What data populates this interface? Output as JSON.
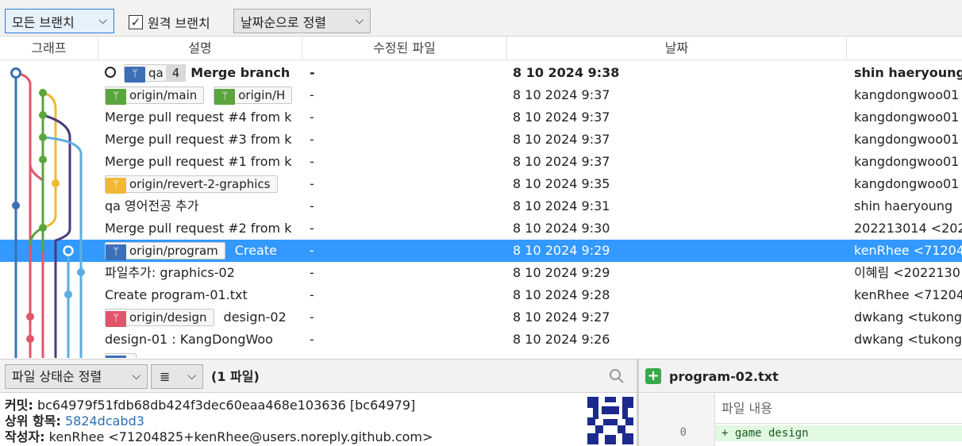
{
  "toolbar": {
    "branch_dropdown": "모든 브랜치",
    "remote_checkbox_label": "원격 브랜치",
    "remote_checked": true,
    "sort_dropdown": "날짜순으로 정렬"
  },
  "columns": {
    "graph": "그래프",
    "description": "설명",
    "files": "수정된 파일",
    "date": "날짜"
  },
  "commits": [
    {
      "branch_tag": "qa",
      "count_badge": "4",
      "description": "Merge branch",
      "files": "-",
      "date": "8 10 2024 9:38",
      "author": "shin haeryoung"
    },
    {
      "tags": [
        "origin/main",
        "origin/H"
      ],
      "files": "-",
      "date": "8 10 2024 9:37",
      "author": "kangdongwoo01"
    },
    {
      "description": "Merge pull request #4 from k",
      "files": "-",
      "date": "8 10 2024 9:37",
      "author": "kangdongwoo01"
    },
    {
      "description": "Merge pull request #3 from k",
      "files": "-",
      "date": "8 10 2024 9:37",
      "author": "kangdongwoo01"
    },
    {
      "description": "Merge pull request #1 from k",
      "files": "-",
      "date": "8 10 2024 9:37",
      "author": "kangdongwoo01"
    },
    {
      "tags": [
        "origin/revert-2-graphics"
      ],
      "files": "-",
      "date": "8 10 2024 9:35",
      "author": "kangdongwoo01"
    },
    {
      "description": "qa 영어전공 추가",
      "files": "-",
      "date": "8 10 2024 9:31",
      "author": "shin haeryoung"
    },
    {
      "description": "Merge pull request #2 from k",
      "files": "-",
      "date": "8 10 2024 9:30",
      "author": "202213014 <202"
    },
    {
      "tags": [
        "origin/program"
      ],
      "description": "Create",
      "files": "-",
      "date": "8 10 2024 9:29",
      "author": "kenRhee <71204"
    },
    {
      "description": "파일추가: graphics-02",
      "files": "-",
      "date": "8 10 2024 9:29",
      "author": "이혜림 <2022130"
    },
    {
      "description": "Create program-01.txt",
      "files": "-",
      "date": "8 10 2024 9:28",
      "author": "kenRhee <71204"
    },
    {
      "tags": [
        "origin/design"
      ],
      "description": "design-02",
      "files": "-",
      "date": "8 10 2024 9:27",
      "author": "dwkang <tukong"
    },
    {
      "description": "design-01 : KangDongWoo",
      "files": "-",
      "date": "8 10 2024 9:26",
      "author": "dwkang <tukong"
    }
  ],
  "file_panel": {
    "sort_label": "파일 상태순 정렬",
    "view_label": "≣",
    "file_count": "(1 파일)"
  },
  "details": {
    "commit_label": "커밋:",
    "commit_value": "bc64979f51fdb68db424f3dec60eaa468e103636 [bc64979]",
    "parent_label": "상위 항목:",
    "parent_value": "5824dcabd3",
    "author_label": "작성자:",
    "author_value": "kenRhee <71204825+kenRhee@users.noreply.github.com>"
  },
  "diff": {
    "file_name": "program-02.txt",
    "content_header": "파일 내용",
    "line_number": "0",
    "line_text": "+ game design"
  },
  "colors": {
    "selection": "#3399ff",
    "blue": "#3c6fb6",
    "green": "#5aa53e",
    "yellow": "#f0b834",
    "red": "#e0556a",
    "purple": "#4b3a7a",
    "lightblue": "#5aaee0"
  }
}
